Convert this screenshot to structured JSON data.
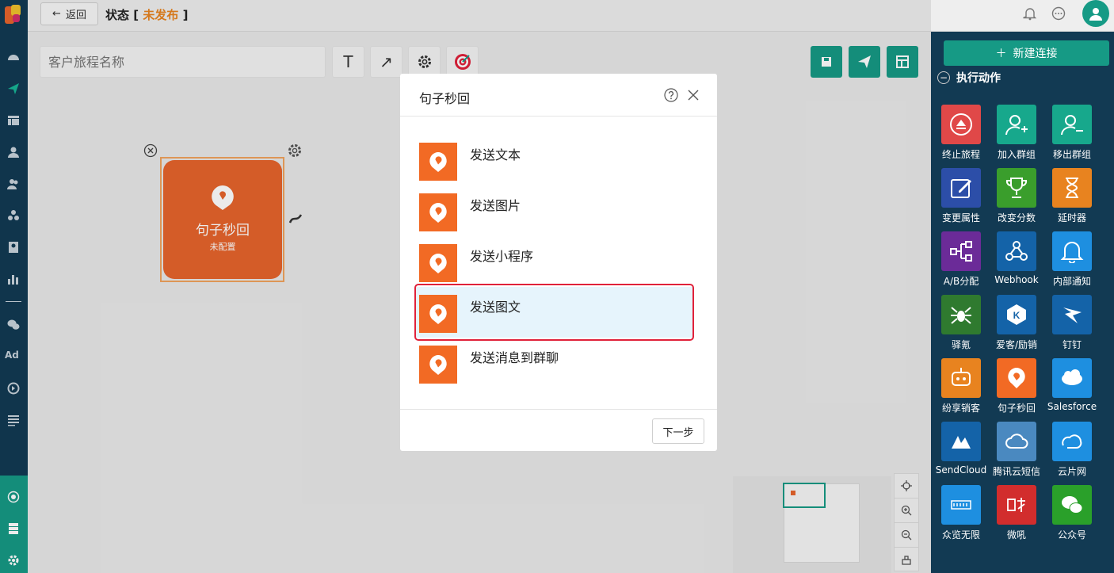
{
  "header": {
    "back_label": "返回",
    "status_prefix": "状态",
    "status_open": " [ ",
    "status_value": "未发布",
    "status_close": " ]"
  },
  "canvas": {
    "journey_name_placeholder": "客户旅程名称",
    "text_tool_glyph": "T",
    "arrow_tool_glyph": "↗",
    "node": {
      "title": "句子秒回",
      "subtitle": "未配置"
    }
  },
  "right_panel": {
    "new_connection_label": "新建连接",
    "section_title": "执行动作",
    "actions": [
      {
        "label": "终止旅程",
        "icon": "stop-journey-icon",
        "color": "#e04848"
      },
      {
        "label": "加入群组",
        "icon": "add-group-icon",
        "color": "#17a88c"
      },
      {
        "label": "移出群组",
        "icon": "remove-group-icon",
        "color": "#17a88c"
      },
      {
        "label": "变更属性",
        "icon": "edit-attribute-icon",
        "color": "#2c4ea8"
      },
      {
        "label": "改变分数",
        "icon": "trophy-icon",
        "color": "#3a9e2c"
      },
      {
        "label": "延时器",
        "icon": "hourglass-icon",
        "color": "#e8831f"
      },
      {
        "label": "A/B分配",
        "icon": "ab-split-icon",
        "color": "#6b2b98"
      },
      {
        "label": "Webhook",
        "icon": "webhook-icon",
        "color": "#1463a8"
      },
      {
        "label": "内部通知",
        "icon": "bell-icon",
        "color": "#1e8fe0"
      },
      {
        "label": "驿氪",
        "icon": "spider-icon",
        "color": "#2f7a2f"
      },
      {
        "label": "爱客/励销",
        "icon": "aike-icon",
        "color": "#1463a8"
      },
      {
        "label": "钉钉",
        "icon": "dingtalk-icon",
        "color": "#1463a8"
      },
      {
        "label": "纷享销客",
        "icon": "fxiaoke-icon",
        "color": "#e8831f"
      },
      {
        "label": "句子秒回",
        "icon": "juzi-icon",
        "color": "#f26a24"
      },
      {
        "label": "Salesforce",
        "icon": "salesforce-icon",
        "color": "#1e8fe0"
      },
      {
        "label": "SendCloud",
        "icon": "sendcloud-icon",
        "color": "#1463a8"
      },
      {
        "label": "腾讯云短信",
        "icon": "tencent-cloud-icon",
        "color": "#4a89c0"
      },
      {
        "label": "云片网",
        "icon": "yunpian-icon",
        "color": "#1e8fe0"
      },
      {
        "label": "众览无限",
        "icon": "zhonglan-icon",
        "color": "#1e8fe0"
      },
      {
        "label": "微吼",
        "icon": "weihou-icon",
        "color": "#d22d2d"
      },
      {
        "label": "公众号",
        "icon": "wechat-icon",
        "color": "#2aa02a"
      }
    ]
  },
  "modal": {
    "title": "句子秒回",
    "options": [
      {
        "label": "发送文本",
        "selected": false
      },
      {
        "label": "发送图片",
        "selected": false
      },
      {
        "label": "发送小程序",
        "selected": false
      },
      {
        "label": "发送图文",
        "selected": true
      },
      {
        "label": "发送消息到群聊",
        "selected": false
      }
    ],
    "next_label": "下一步"
  },
  "colors": {
    "nav_bg": "#123a53",
    "accent_green": "#169a85",
    "node_orange": "#e6642c",
    "draft_orange": "#e8831f",
    "highlight_red": "#e0213a"
  },
  "nav": {
    "ad_label": "Ad"
  }
}
